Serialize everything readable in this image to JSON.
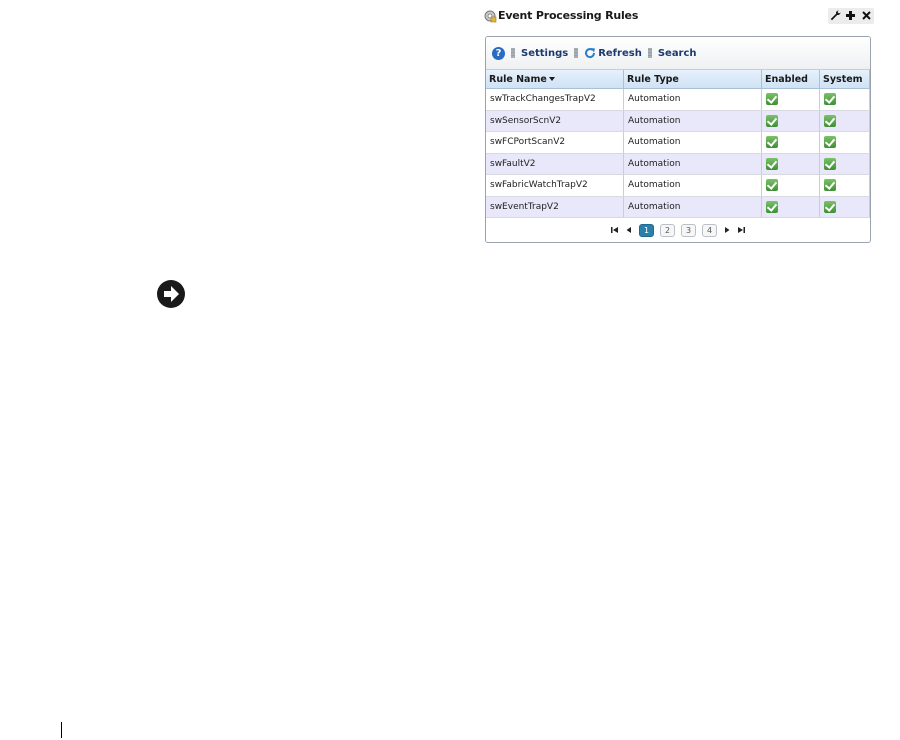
{
  "portlet": {
    "title": "Event Processing Rules",
    "tools": [
      "wrench-icon",
      "plus-icon",
      "close-icon"
    ]
  },
  "toolbar": {
    "help_icon": "help-icon",
    "settings_label": "Settings",
    "refresh_label": "Refresh",
    "search_label": "Search"
  },
  "table": {
    "headers": [
      "Rule Name",
      "Rule Type",
      "Enabled",
      "System"
    ],
    "sort_column": "Rule Name",
    "rows": [
      {
        "name": "swTrackChangesTrapV2",
        "type": "Automation",
        "enabled": true,
        "system": true
      },
      {
        "name": "swSensorScnV2",
        "type": "Automation",
        "enabled": true,
        "system": true
      },
      {
        "name": "swFCPortScanV2",
        "type": "Automation",
        "enabled": true,
        "system": true
      },
      {
        "name": "swFaultV2",
        "type": "Automation",
        "enabled": true,
        "system": true
      },
      {
        "name": "swFabricWatchTrapV2",
        "type": "Automation",
        "enabled": true,
        "system": true
      },
      {
        "name": "swEventTrapV2",
        "type": "Automation",
        "enabled": true,
        "system": true
      }
    ]
  },
  "pager": {
    "pages": [
      "1",
      "2",
      "3",
      "4"
    ],
    "current": "1"
  },
  "colors": {
    "header_gradient_top": "#e6f1fb",
    "alt_row": "#e9e8fa",
    "active_page": "#2c7fa8",
    "link_text": "#1c3a6e"
  }
}
